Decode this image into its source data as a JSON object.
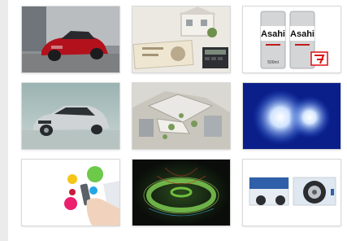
{
  "gallery": {
    "thumbnails": [
      {
        "subject": "red-sports-car"
      },
      {
        "subject": "house-model-with-banknotes"
      },
      {
        "subject": "beer-cans",
        "brand_text": "Asahi",
        "can_label": "SUPER DRY",
        "volume": "500ml"
      },
      {
        "subject": "silver-sedan"
      },
      {
        "subject": "aerial-development-rendering"
      },
      {
        "subject": "blue-glowing-orbs"
      },
      {
        "subject": "colorful-dots-with-phone"
      },
      {
        "subject": "green-particle-ring"
      },
      {
        "subject": "vehicle-wheel-parts"
      }
    ]
  }
}
